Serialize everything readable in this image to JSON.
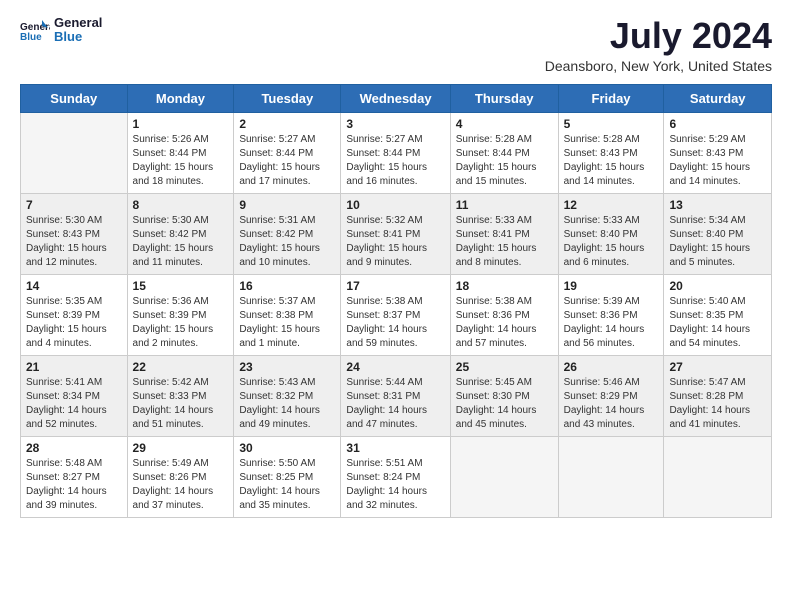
{
  "header": {
    "logo_general": "General",
    "logo_blue": "Blue",
    "month_title": "July 2024",
    "location": "Deansboro, New York, United States"
  },
  "weekdays": [
    "Sunday",
    "Monday",
    "Tuesday",
    "Wednesday",
    "Thursday",
    "Friday",
    "Saturday"
  ],
  "weeks": [
    [
      {
        "day": "",
        "info": ""
      },
      {
        "day": "1",
        "info": "Sunrise: 5:26 AM\nSunset: 8:44 PM\nDaylight: 15 hours\nand 18 minutes."
      },
      {
        "day": "2",
        "info": "Sunrise: 5:27 AM\nSunset: 8:44 PM\nDaylight: 15 hours\nand 17 minutes."
      },
      {
        "day": "3",
        "info": "Sunrise: 5:27 AM\nSunset: 8:44 PM\nDaylight: 15 hours\nand 16 minutes."
      },
      {
        "day": "4",
        "info": "Sunrise: 5:28 AM\nSunset: 8:44 PM\nDaylight: 15 hours\nand 15 minutes."
      },
      {
        "day": "5",
        "info": "Sunrise: 5:28 AM\nSunset: 8:43 PM\nDaylight: 15 hours\nand 14 minutes."
      },
      {
        "day": "6",
        "info": "Sunrise: 5:29 AM\nSunset: 8:43 PM\nDaylight: 15 hours\nand 14 minutes."
      }
    ],
    [
      {
        "day": "7",
        "info": "Sunrise: 5:30 AM\nSunset: 8:43 PM\nDaylight: 15 hours\nand 12 minutes."
      },
      {
        "day": "8",
        "info": "Sunrise: 5:30 AM\nSunset: 8:42 PM\nDaylight: 15 hours\nand 11 minutes."
      },
      {
        "day": "9",
        "info": "Sunrise: 5:31 AM\nSunset: 8:42 PM\nDaylight: 15 hours\nand 10 minutes."
      },
      {
        "day": "10",
        "info": "Sunrise: 5:32 AM\nSunset: 8:41 PM\nDaylight: 15 hours\nand 9 minutes."
      },
      {
        "day": "11",
        "info": "Sunrise: 5:33 AM\nSunset: 8:41 PM\nDaylight: 15 hours\nand 8 minutes."
      },
      {
        "day": "12",
        "info": "Sunrise: 5:33 AM\nSunset: 8:40 PM\nDaylight: 15 hours\nand 6 minutes."
      },
      {
        "day": "13",
        "info": "Sunrise: 5:34 AM\nSunset: 8:40 PM\nDaylight: 15 hours\nand 5 minutes."
      }
    ],
    [
      {
        "day": "14",
        "info": "Sunrise: 5:35 AM\nSunset: 8:39 PM\nDaylight: 15 hours\nand 4 minutes."
      },
      {
        "day": "15",
        "info": "Sunrise: 5:36 AM\nSunset: 8:39 PM\nDaylight: 15 hours\nand 2 minutes."
      },
      {
        "day": "16",
        "info": "Sunrise: 5:37 AM\nSunset: 8:38 PM\nDaylight: 15 hours\nand 1 minute."
      },
      {
        "day": "17",
        "info": "Sunrise: 5:38 AM\nSunset: 8:37 PM\nDaylight: 14 hours\nand 59 minutes."
      },
      {
        "day": "18",
        "info": "Sunrise: 5:38 AM\nSunset: 8:36 PM\nDaylight: 14 hours\nand 57 minutes."
      },
      {
        "day": "19",
        "info": "Sunrise: 5:39 AM\nSunset: 8:36 PM\nDaylight: 14 hours\nand 56 minutes."
      },
      {
        "day": "20",
        "info": "Sunrise: 5:40 AM\nSunset: 8:35 PM\nDaylight: 14 hours\nand 54 minutes."
      }
    ],
    [
      {
        "day": "21",
        "info": "Sunrise: 5:41 AM\nSunset: 8:34 PM\nDaylight: 14 hours\nand 52 minutes."
      },
      {
        "day": "22",
        "info": "Sunrise: 5:42 AM\nSunset: 8:33 PM\nDaylight: 14 hours\nand 51 minutes."
      },
      {
        "day": "23",
        "info": "Sunrise: 5:43 AM\nSunset: 8:32 PM\nDaylight: 14 hours\nand 49 minutes."
      },
      {
        "day": "24",
        "info": "Sunrise: 5:44 AM\nSunset: 8:31 PM\nDaylight: 14 hours\nand 47 minutes."
      },
      {
        "day": "25",
        "info": "Sunrise: 5:45 AM\nSunset: 8:30 PM\nDaylight: 14 hours\nand 45 minutes."
      },
      {
        "day": "26",
        "info": "Sunrise: 5:46 AM\nSunset: 8:29 PM\nDaylight: 14 hours\nand 43 minutes."
      },
      {
        "day": "27",
        "info": "Sunrise: 5:47 AM\nSunset: 8:28 PM\nDaylight: 14 hours\nand 41 minutes."
      }
    ],
    [
      {
        "day": "28",
        "info": "Sunrise: 5:48 AM\nSunset: 8:27 PM\nDaylight: 14 hours\nand 39 minutes."
      },
      {
        "day": "29",
        "info": "Sunrise: 5:49 AM\nSunset: 8:26 PM\nDaylight: 14 hours\nand 37 minutes."
      },
      {
        "day": "30",
        "info": "Sunrise: 5:50 AM\nSunset: 8:25 PM\nDaylight: 14 hours\nand 35 minutes."
      },
      {
        "day": "31",
        "info": "Sunrise: 5:51 AM\nSunset: 8:24 PM\nDaylight: 14 hours\nand 32 minutes."
      },
      {
        "day": "",
        "info": ""
      },
      {
        "day": "",
        "info": ""
      },
      {
        "day": "",
        "info": ""
      }
    ]
  ]
}
